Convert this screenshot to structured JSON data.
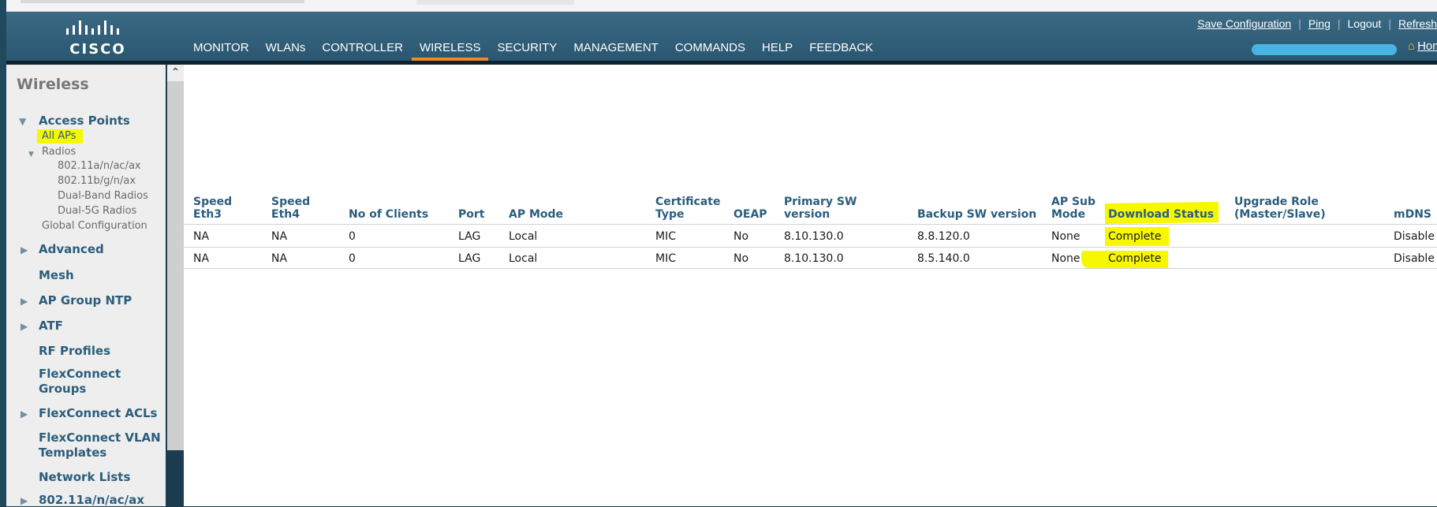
{
  "header": {
    "logo_text": "CISCO",
    "top_links": [
      "Save Configuration",
      "Ping",
      "Logout",
      "Refresh"
    ],
    "nav_items": [
      "MONITOR",
      "WLANs",
      "CONTROLLER",
      "WIRELESS",
      "SECURITY",
      "MANAGEMENT",
      "COMMANDS",
      "HELP",
      "FEEDBACK"
    ],
    "active_nav": "WIRELESS",
    "home_label": "Home"
  },
  "sidebar": {
    "title": "Wireless",
    "access_points": "Access Points",
    "all_aps": "All APs",
    "radios": "Radios",
    "radio_items": [
      "802.11a/n/ac/ax",
      "802.11b/g/n/ax",
      "Dual-Band Radios",
      "Dual-5G Radios"
    ],
    "global_config": "Global Configuration",
    "items": [
      "Advanced",
      "Mesh",
      "AP Group NTP",
      "ATF",
      "RF Profiles",
      "FlexConnect Groups",
      "FlexConnect ACLs",
      "FlexConnect VLAN Templates",
      "Network Lists",
      "802.11a/n/ac/ax"
    ]
  },
  "table": {
    "columns": [
      "Speed Eth3",
      "Speed Eth4",
      "No of Clients",
      "Port",
      "AP Mode",
      "Certificate Type",
      "OEAP",
      "Primary SW version",
      "Backup SW version",
      "AP Sub Mode",
      "Download Status",
      "Upgrade Role (Master/Slave)",
      "mDNS"
    ],
    "column_lines": {
      "speed_eth3": [
        "Speed",
        "Eth3"
      ],
      "speed_eth4": [
        "Speed",
        "Eth4"
      ],
      "cert_type": [
        "Certificate",
        "Type"
      ],
      "primary_sw": [
        "Primary SW",
        "version"
      ],
      "ap_sub_mode": [
        "AP Sub",
        "Mode"
      ],
      "upgrade_role": [
        "Upgrade Role",
        "(Master/Slave)"
      ]
    },
    "rows": [
      [
        "NA",
        "NA",
        "0",
        "LAG",
        "Local",
        "MIC",
        "No",
        "8.10.130.0",
        "8.8.120.0",
        "None",
        "Complete",
        "",
        "Disable"
      ],
      [
        "NA",
        "NA",
        "0",
        "LAG",
        "Local",
        "MIC",
        "No",
        "8.10.130.0",
        "8.5.140.0",
        "None",
        "Complete",
        "",
        "Disable"
      ]
    ]
  },
  "colors": {
    "header": "#2a5670",
    "active_tab_underline": "#f08a24",
    "highlight": "#f7f700",
    "link": "#2b5d7d"
  }
}
